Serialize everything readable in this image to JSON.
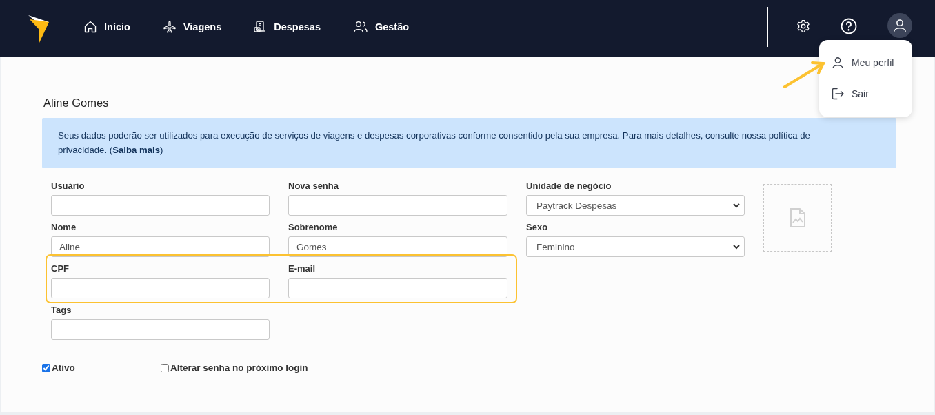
{
  "nav": {
    "items": [
      {
        "label": "Início"
      },
      {
        "label": "Viagens"
      },
      {
        "label": "Despesas"
      },
      {
        "label": "Gestão"
      }
    ]
  },
  "user_menu": {
    "items": [
      {
        "label": "Meu perfil",
        "highlighted": true
      },
      {
        "label": "Sair",
        "highlighted": false
      }
    ]
  },
  "page_title": "Aline Gomes",
  "notice": "Seus dados poderão ser utilizados para execução de serviços de viagens e despesas corporativas conforme consentido pela sua empresa. Para mais detalhes, consulte nossa política de privacidade. (**Saiba mais**)",
  "form": {
    "rows": [
      {
        "highlighted": false,
        "fields": [
          {
            "kind": "input",
            "label": "Usuário"
          },
          {
            "kind": "input",
            "label": "Nova senha"
          },
          {
            "kind": "select",
            "label": "Unidade de negócio",
            "value": "Paytrack Despesas"
          }
        ]
      },
      {
        "highlighted": false,
        "fields": [
          {
            "kind": "input",
            "label": "Nome",
            "value": "Aline"
          },
          {
            "kind": "input",
            "label": "Sobrenome",
            "value": "Gomes"
          },
          {
            "kind": "select",
            "label": "Sexo",
            "value": "Feminino"
          }
        ]
      },
      {
        "highlighted": true,
        "fields": [
          {
            "kind": "input",
            "label": "CPF"
          },
          {
            "kind": "input",
            "label": "E-mail"
          }
        ]
      },
      {
        "highlighted": false,
        "fields": [
          {
            "kind": "input",
            "label": "Tags"
          }
        ]
      }
    ],
    "checkboxes": [
      {
        "label": "Ativo",
        "checked": true
      },
      {
        "label": "Alterar senha no próximo login",
        "checked": false
      }
    ]
  }
}
